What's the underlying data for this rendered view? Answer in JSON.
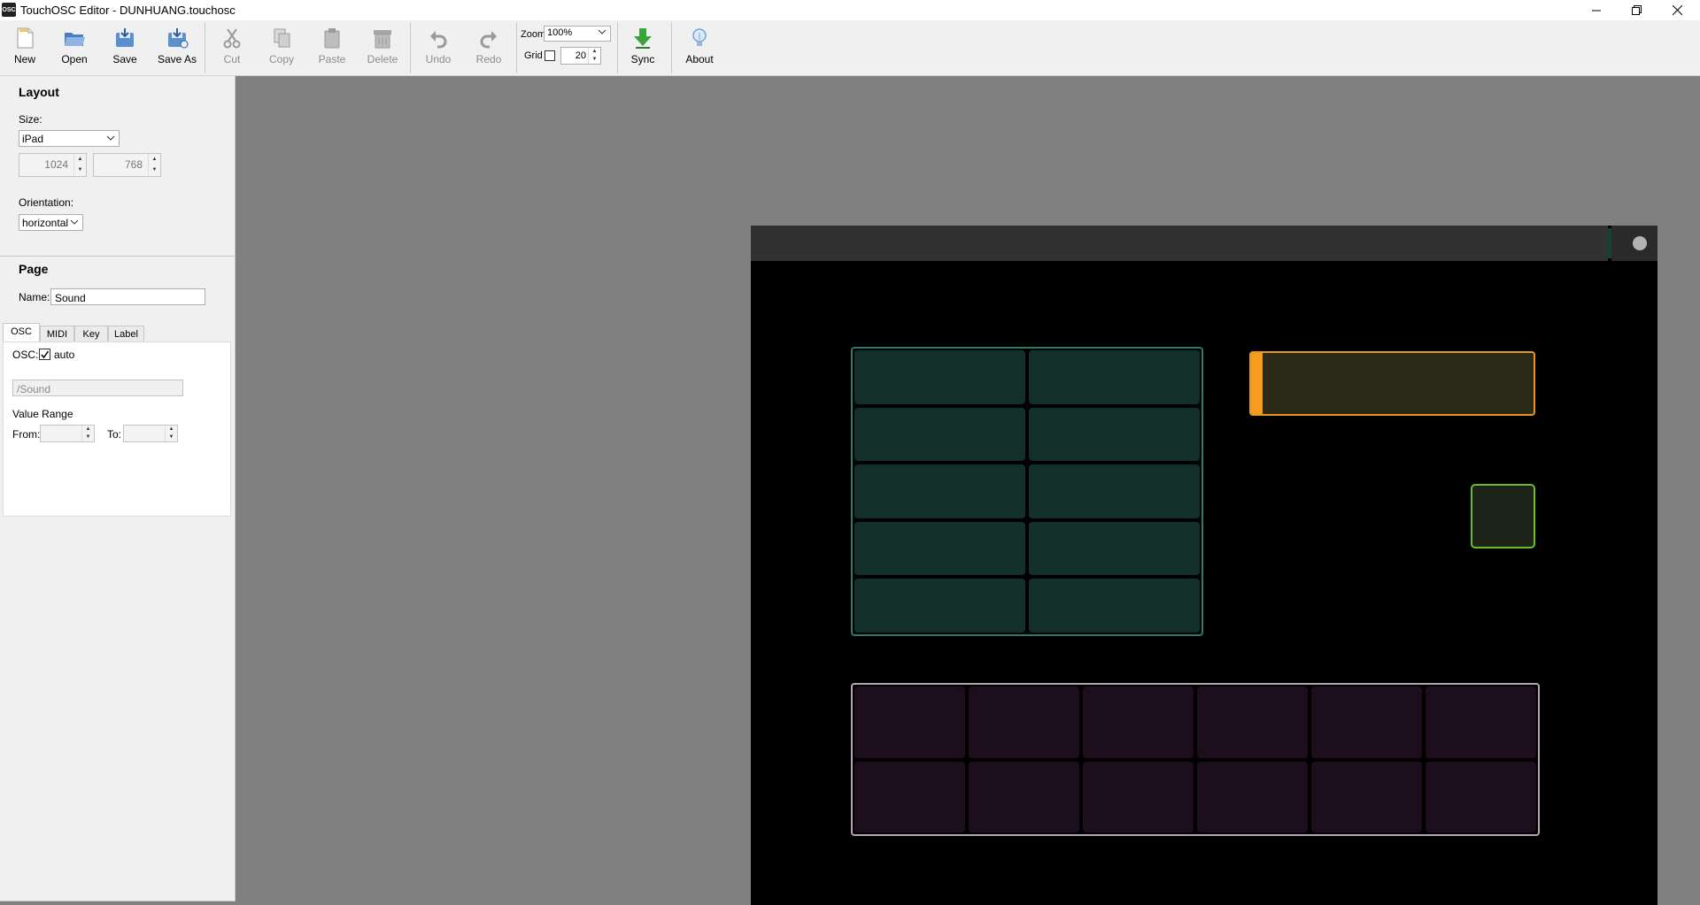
{
  "window": {
    "app_icon_text": "OSC",
    "title": "TouchOSC Editor - DUNHUANG.touchosc"
  },
  "toolbar": {
    "new": "New",
    "open": "Open",
    "save": "Save",
    "save_as": "Save As",
    "cut": "Cut",
    "copy": "Copy",
    "paste": "Paste",
    "delete": "Delete",
    "undo": "Undo",
    "redo": "Redo",
    "zoom_label": "Zoom",
    "zoom_value": "100%",
    "grid_label": "Grid",
    "grid_checked": false,
    "grid_value": "20",
    "sync": "Sync",
    "about": "About"
  },
  "layout": {
    "title": "Layout",
    "size_label": "Size:",
    "size_value": "iPad",
    "width": "1024",
    "height": "768",
    "orientation_label": "Orientation:",
    "orientation_value": "horizontal"
  },
  "page": {
    "title": "Page",
    "name_label": "Name:",
    "name_value": "Sound",
    "tabs": [
      "OSC",
      "MIDI",
      "Key",
      "Label"
    ],
    "active_tab": "OSC",
    "osc_label": "OSC:",
    "auto_label": "auto",
    "auto_checked": true,
    "address_placeholder": "/Sound",
    "value_range_label": "Value Range",
    "from_label": "From:",
    "to_label": "To:"
  },
  "colors": {
    "multitoggle_1": "#2c7a67",
    "fader": "#f59b1d",
    "toggle": "#6bbd2f",
    "multitoggle_2": "#b3a3b3"
  },
  "controls": {
    "multitoggle_1": {
      "columns": 2,
      "rows": 5
    },
    "multitoggle_2": {
      "columns": 6,
      "rows": 2
    },
    "fader": {
      "value": 0
    }
  }
}
